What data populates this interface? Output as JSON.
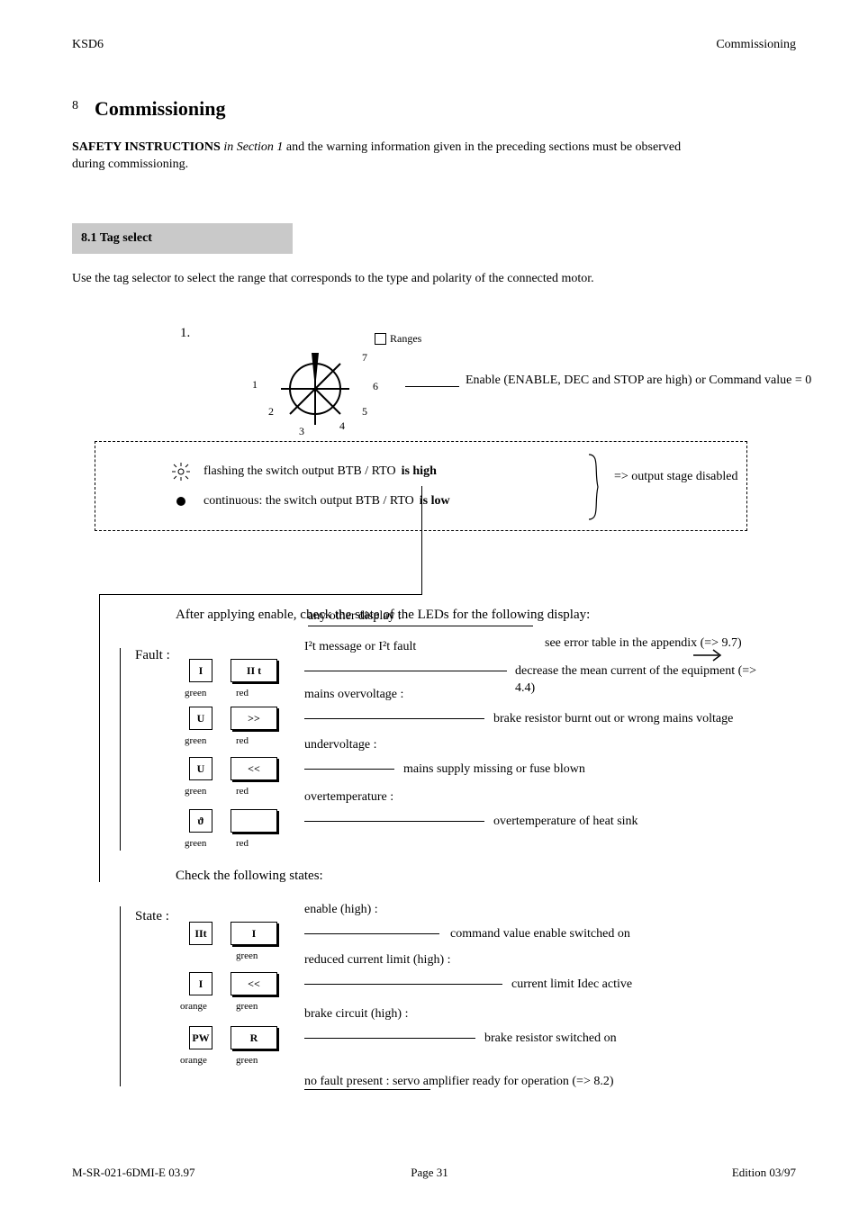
{
  "header": {
    "left": "KSD6",
    "right": "Commissioning"
  },
  "page": {
    "prefix": "8",
    "title": "Commissioning"
  },
  "section_intro": {
    "lead_bold": "SAFETY INSTRUCTIONS",
    "note_italic": "in Section 1",
    "lead_tail": " and the warning information given in the preceding sections must be observed",
    "line2": "during commissioning."
  },
  "tagselect": {
    "label": "8.1 Tag select",
    "intro": "Use the tag selector to select the range that corresponds to the type and polarity of the connected motor.",
    "step": "1.",
    "ticks": [
      "1",
      "2",
      "3",
      "4",
      "5",
      "6",
      "7"
    ],
    "ranges_label": "Ranges",
    "knob_caption": "Enable (ENABLE, DEC and STOP are high)\nor Command value = 0"
  },
  "led_panel": {
    "row1_text": "flashing the switch output  BTB / RTO",
    "row1_led": "is high",
    "row2_text": "continuous: the switch output  BTB / RTO",
    "row2_led": "is low",
    "right_text": "=> output stage disabled"
  },
  "check_header": "After applying enable, check the state of the LEDs for the following display:",
  "group1": {
    "title": "Fault :",
    "rows": [
      {
        "i": 0,
        "l": "Ι",
        "d": "ΙΙ t",
        "mini": "Ι²t message or Ι²t fault",
        "body": "decrease the mean current of the equipment (=> 4.4)",
        "l_lbl": "green",
        "d_lbl": "red",
        "conn_w": 225
      },
      {
        "i": 1,
        "l": "U",
        "d": ">>",
        "mini": "mains overvoltage :",
        "body": "brake resistor burnt out or wrong mains voltage",
        "l_lbl": "green",
        "d_lbl": "red",
        "conn_w": 200
      },
      {
        "i": 2,
        "l": "U",
        "d": "<<",
        "mini": "undervoltage :",
        "body": "mains supply missing or fuse blown",
        "l_lbl": "green",
        "d_lbl": "red",
        "conn_w": 100
      },
      {
        "i": 3,
        "l": "ϑ",
        "d": " ",
        "mini": "overtemperature :",
        "body": "overtemperature of heat sink",
        "l_lbl": "green",
        "d_lbl": "red",
        "conn_w": 200
      }
    ]
  },
  "check_header2": "Check the following states:",
  "group2": {
    "title": "State :",
    "rows": [
      {
        "i": 0,
        "l": "ΙΙt",
        "d": "Ι",
        "mini": "enable (high) :",
        "body": "command value enable switched on",
        "l_lbl": "",
        "d_lbl": "green",
        "conn_w": 150
      },
      {
        "i": 1,
        "l": "Ι",
        "d": "<<",
        "mini": "reduced current limit (high) :",
        "body": "current limit Ιdec active",
        "l_lbl": "orange",
        "d_lbl": "green",
        "conn_w": 220
      },
      {
        "i": 2,
        "l": "PW",
        "d": "R",
        "mini": "brake circuit (high) :",
        "body": "brake resistor switched on",
        "l_lbl": "orange",
        "d_lbl": "green",
        "conn_w": 190
      }
    ],
    "footer": "no fault present : servo amplifier ready for operation (=> 8.2)"
  },
  "footer": {
    "left": "M-SR-021-6DMI-E\t03.97",
    "mid": "Page 31",
    "right": "Edition 03/97"
  },
  "arrow_any_fault": "any other display :"
}
